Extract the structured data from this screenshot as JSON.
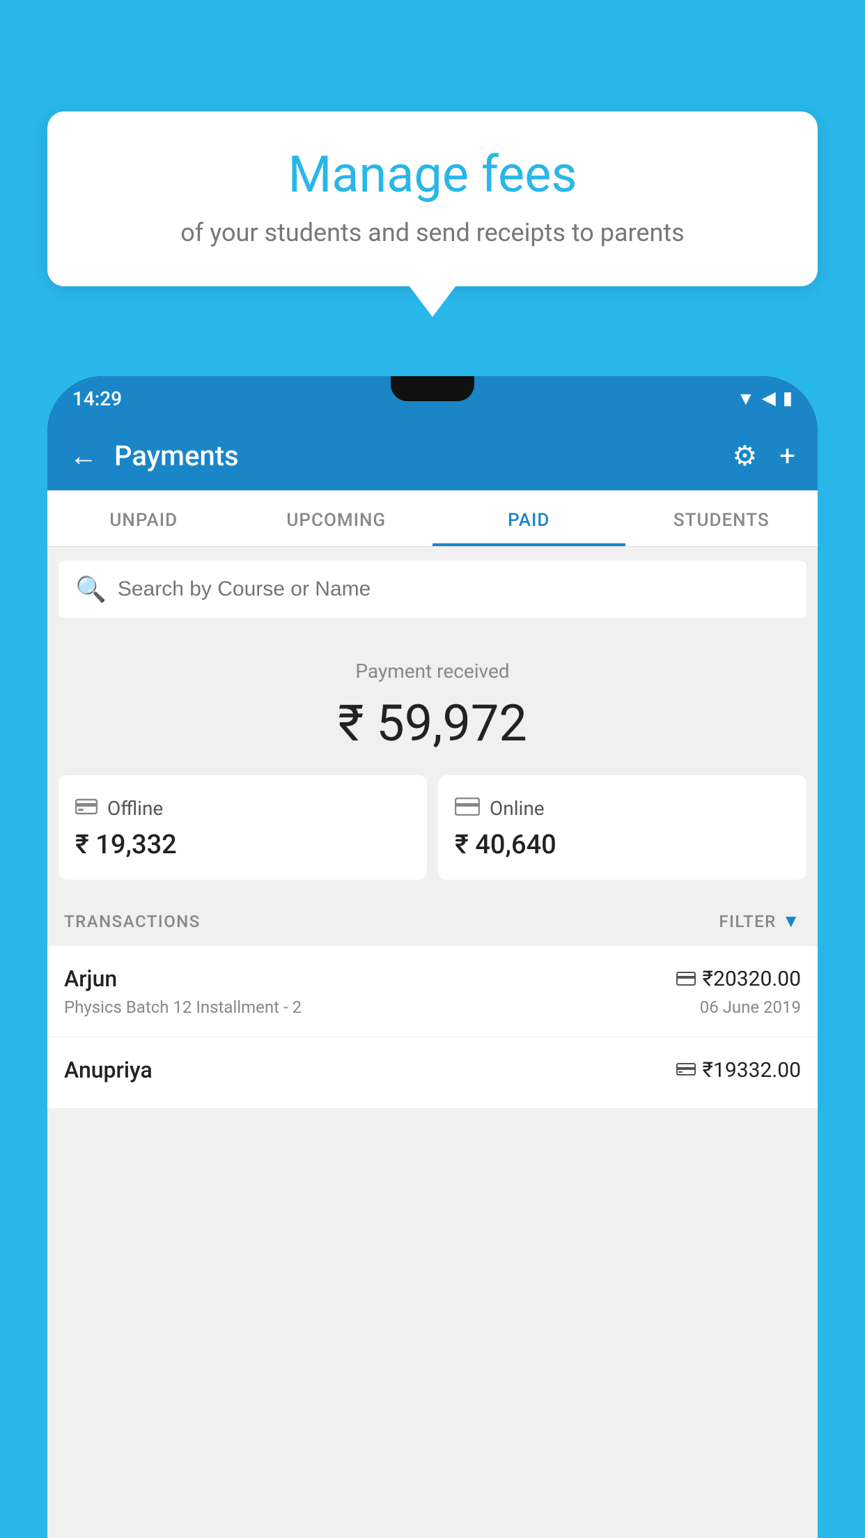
{
  "background_color": "#29b6e8",
  "tooltip": {
    "title": "Manage fees",
    "subtitle": "of your students and send receipts to parents"
  },
  "status_bar": {
    "time": "14:29",
    "icons": "▼◀▮"
  },
  "app_bar": {
    "title": "Payments",
    "back_label": "←",
    "settings_label": "⚙",
    "add_label": "+"
  },
  "tabs": [
    {
      "label": "UNPAID",
      "active": false
    },
    {
      "label": "UPCOMING",
      "active": false
    },
    {
      "label": "PAID",
      "active": true
    },
    {
      "label": "STUDENTS",
      "active": false
    }
  ],
  "search": {
    "placeholder": "Search by Course or Name"
  },
  "payment_received": {
    "label": "Payment received",
    "amount": "₹ 59,972"
  },
  "payment_cards": [
    {
      "type": "Offline",
      "amount": "₹ 19,332",
      "icon": "💳"
    },
    {
      "type": "Online",
      "amount": "₹ 40,640",
      "icon": "💳"
    }
  ],
  "transactions_label": "TRANSACTIONS",
  "filter_label": "FILTER",
  "transactions": [
    {
      "name": "Arjun",
      "amount": "₹20320.00",
      "description": "Physics Batch 12 Installment - 2",
      "date": "06 June 2019",
      "payment_type": "online"
    },
    {
      "name": "Anupriya",
      "amount": "₹19332.00",
      "description": "",
      "date": "",
      "payment_type": "offline"
    }
  ]
}
